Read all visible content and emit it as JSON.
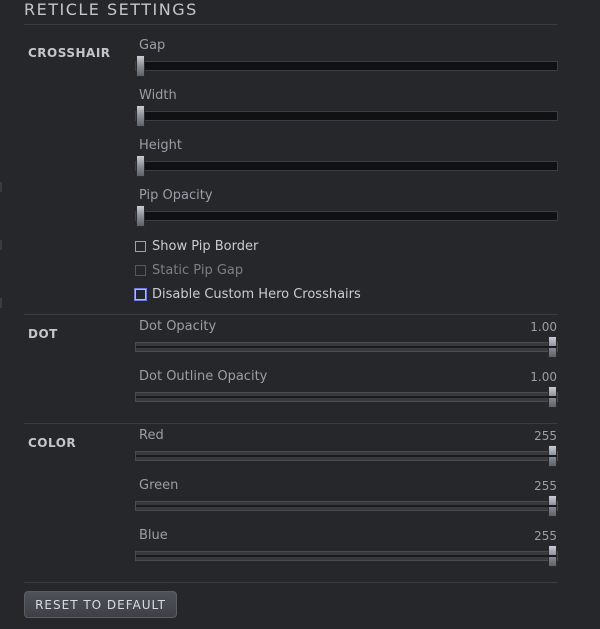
{
  "title": "RETICLE SETTINGS",
  "sections": {
    "crosshair": {
      "label": "CROSSHAIR",
      "sliders": [
        {
          "label": "Gap",
          "level": 0
        },
        {
          "label": "Width",
          "level": 0
        },
        {
          "label": "Height",
          "level": 0
        },
        {
          "label": "Pip Opacity",
          "level": 0
        }
      ],
      "checkboxes": [
        {
          "label": "Show Pip Border",
          "checked": false,
          "enabled": true
        },
        {
          "label": "Static Pip Gap",
          "checked": false,
          "enabled": false
        },
        {
          "label": "Disable Custom Hero Crosshairs",
          "checked": false,
          "enabled": true,
          "focused": true
        }
      ]
    },
    "dot": {
      "label": "DOT",
      "sliders": [
        {
          "label": "Dot Opacity",
          "value": "1.00",
          "level": 1
        },
        {
          "label": "Dot Outline Opacity",
          "value": "1.00",
          "level": 1
        }
      ]
    },
    "color": {
      "label": "COLOR",
      "sliders": [
        {
          "label": "Red",
          "value": "255",
          "level": 1
        },
        {
          "label": "Green",
          "value": "255",
          "level": 1
        },
        {
          "label": "Blue",
          "value": "255",
          "level": 1
        }
      ]
    }
  },
  "reset_label": "RESET TO DEFAULT",
  "colors": {
    "background": "#26272b",
    "focus_accent": "#aeb6ff"
  }
}
